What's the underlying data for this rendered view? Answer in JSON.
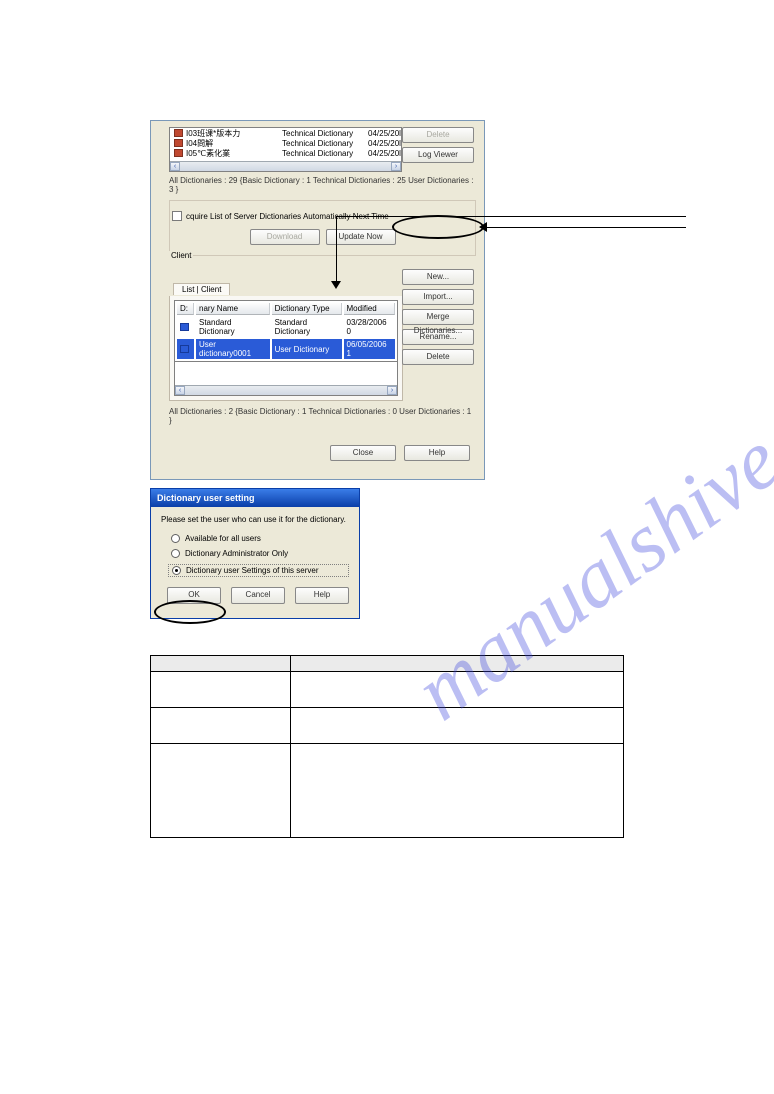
{
  "watermark": "manualshive.com",
  "server": {
    "rows": [
      {
        "name": "I03班课*版本力",
        "type": "Technical Dictionary",
        "modified": "04/25/20l"
      },
      {
        "name": "I04問解",
        "type": "Technical Dictionary",
        "modified": "04/25/20l"
      },
      {
        "name": "I05℃素化業",
        "type": "Technical Dictionary",
        "modified": "04/25/20l"
      }
    ],
    "delete": "Delete",
    "log_viewer": "Log Viewer",
    "summary": "All Dictionaries : 29    {Basic Dictionary : 1  Technical Dictionaries : 25  User Dictionaries : 3    }"
  },
  "group": {
    "checkbox": "cquire List of Server Dictionaries Automatically Next Time",
    "download": "Download",
    "update": "Update Now"
  },
  "client": {
    "label": "Client",
    "tab": "List  | Client",
    "cols": {
      "name": "nary Name",
      "type": "Dictionary Type",
      "mod": "Modified"
    },
    "rows": [
      {
        "name": "Standard Dictionary",
        "type": "Standard Dictionary",
        "mod": "03/28/2006 0"
      },
      {
        "name": "User dictionary0001",
        "type": "User Dictionary",
        "mod": "06/05/2006 1"
      }
    ],
    "buttons": {
      "new": "New...",
      "import": "Import...",
      "merge": "Merge Dictionaries...",
      "rename": "Rename...",
      "delete": "Delete"
    },
    "summary": "All Dictionaries : 2     {Basic Dictionary : 1  Technical Dictionaries : 0   User Dictionaries : 1    }"
  },
  "bottom": {
    "close": "Close",
    "help": "Help"
  },
  "dlg2": {
    "title": "Dictionary user setting",
    "prompt": "Please set the user who can use it for the dictionary.",
    "opt1": "Available for all users",
    "opt2": "Dictionary Administrator Only",
    "opt3": "Dictionary user Settings of this server",
    "ok": "OK",
    "cancel": "Cancel",
    "help": "Help"
  },
  "table": {
    "h1": "",
    "h2": "",
    "r1c1": "",
    "r1c2": "",
    "r2c1": "",
    "r2c2": "",
    "r3c1": "",
    "r3c2": ""
  }
}
